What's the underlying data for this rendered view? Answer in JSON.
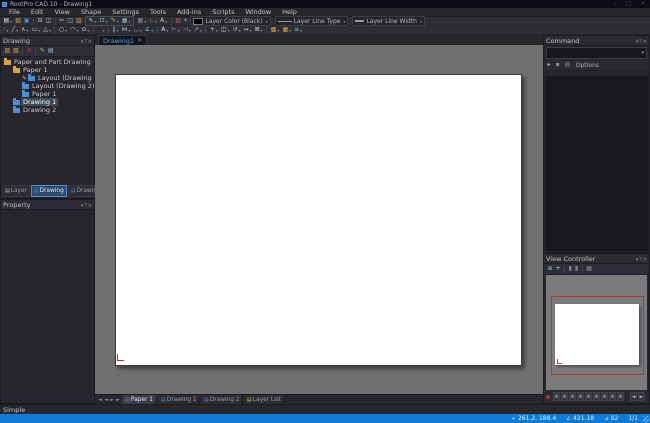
{
  "window": {
    "title": "RootPro CAD 10 - Drawing1",
    "controls": [
      "–",
      "□",
      "×"
    ]
  },
  "menu": [
    "File",
    "Edit",
    "View",
    "Shape",
    "Settings",
    "Tools",
    "Add-ins",
    "Scripts",
    "Window",
    "Help"
  ],
  "glyphs": {
    "caret": "▾",
    "close": "×",
    "panel_buttons": [
      "▾",
      "⊤",
      "×"
    ]
  },
  "toolbar_top": {
    "file_group": [
      {
        "name": "new-file",
        "glyph": "▤",
        "color": "#e4e4ea",
        "dropdown": true
      },
      {
        "name": "open-file",
        "glyph": "▧",
        "color": "#d9a33c"
      },
      {
        "name": "save-file",
        "glyph": "▣",
        "color": "#4d8fd6"
      },
      {
        "sep": true
      },
      {
        "name": "print",
        "glyph": "⊟",
        "color": "#b8b8c0"
      },
      {
        "name": "print-preview",
        "glyph": "◫",
        "color": "#b8b8c0"
      },
      {
        "sep": true
      },
      {
        "name": "cut",
        "glyph": "✂",
        "color": "#c0c0c8"
      },
      {
        "name": "copy",
        "glyph": "◫",
        "color": "#9fb6d4"
      },
      {
        "name": "paste",
        "glyph": "▥",
        "color": "#d9a33c"
      }
    ],
    "select_group": [
      {
        "name": "select-tool",
        "glyph": "↖",
        "color": "#e8e8ee",
        "dropdown": true
      },
      {
        "name": "select-filter",
        "glyph": "⊡",
        "color": "#9fb6d4",
        "dropdown": true
      },
      {
        "name": "snap-tool",
        "glyph": "✎",
        "color": "#d9c23c",
        "dropdown": true
      },
      {
        "name": "snap-color",
        "glyph": "▦",
        "color": "#9fb6d4",
        "dropdown": true
      }
    ],
    "view_group": [
      {
        "name": "grid-toggle",
        "glyph": "▦",
        "color": "#8a8a94",
        "dropdown": true
      },
      {
        "name": "ortho-toggle",
        "glyph": "∟",
        "color": "#8a8a94",
        "dropdown": true
      },
      {
        "name": "annotation",
        "glyph": "A",
        "color": "#c8c8d0",
        "dropdown": true
      },
      {
        "sep": true
      },
      {
        "name": "format-paint",
        "glyph": "▨",
        "color": "#c05050"
      },
      {
        "name": "more-tools",
        "glyph": "▾",
        "color": "#8a8a94"
      }
    ],
    "layer_color": {
      "label": "Layer Color (Black)",
      "swatch": "#000000"
    },
    "layer_line_type": {
      "label": "Layer Line Type"
    },
    "layer_line_width": {
      "label": "Layer Line Width"
    }
  },
  "toolbar_draw": {
    "tools": [
      {
        "name": "point",
        "glyph": "·",
        "color": "#d0d0d8",
        "dropdown": true
      },
      {
        "name": "line",
        "glyph": "╱",
        "color": "#d0d0d8",
        "dropdown": true
      },
      {
        "name": "polyline",
        "glyph": "∧",
        "color": "#d0d0d8",
        "dropdown": true
      },
      {
        "name": "rectangle",
        "glyph": "▭",
        "color": "#d0d0d8",
        "dropdown": true
      },
      {
        "name": "polygon",
        "glyph": "△",
        "color": "#d0d0d8",
        "dropdown": true
      },
      {
        "sep": true
      },
      {
        "name": "circle",
        "glyph": "○",
        "color": "#d0d0d8",
        "dropdown": true
      },
      {
        "name": "arc",
        "glyph": "◠",
        "color": "#d0d0d8",
        "dropdown": true
      },
      {
        "name": "ellipse",
        "glyph": "⊙",
        "color": "#d0d0d8",
        "dropdown": true
      },
      {
        "sep": true
      },
      {
        "name": "hatch",
        "glyph": "▪",
        "color": "#2a2a30",
        "dropdown": true
      },
      {
        "sep": true
      },
      {
        "name": "offset",
        "glyph": "∥",
        "color": "#9fb6d4",
        "dropdown": true
      },
      {
        "name": "mirror",
        "glyph": "⋈",
        "color": "#9fb6d4",
        "dropdown": true
      },
      {
        "name": "fillet",
        "glyph": "◡",
        "color": "#9fb6d4",
        "dropdown": true
      },
      {
        "name": "chamfer",
        "glyph": "∠",
        "color": "#9fb6d4",
        "dropdown": true
      },
      {
        "sep": true
      },
      {
        "name": "text",
        "glyph": "A",
        "color": "#e0e0e6",
        "dropdown": true
      },
      {
        "name": "dimension-linear",
        "glyph": "⊢",
        "color": "#9fb6d4",
        "dropdown": true
      },
      {
        "name": "dimension-vertical",
        "glyph": "⊣",
        "color": "#9fb6d4",
        "dropdown": true
      },
      {
        "name": "leader",
        "glyph": "↗",
        "color": "#9fb6d4",
        "dropdown": true
      },
      {
        "sep": true
      },
      {
        "name": "move",
        "glyph": "+",
        "color": "#c8c8d0",
        "dropdown": true
      },
      {
        "name": "copy-shape",
        "glyph": "◫",
        "color": "#c8c8d0",
        "dropdown": true
      },
      {
        "name": "rotate",
        "glyph": "↺",
        "color": "#c8c8d0",
        "dropdown": true
      },
      {
        "name": "scale",
        "glyph": "↔",
        "color": "#c8c8d0",
        "dropdown": true
      },
      {
        "name": "erase",
        "glyph": "⊠",
        "color": "#c8c8d0",
        "dropdown": true
      },
      {
        "sep": true
      },
      {
        "name": "group",
        "glyph": "▩",
        "color": "#d9a33c",
        "dropdown": true
      },
      {
        "name": "block",
        "glyph": "▦",
        "color": "#d9a33c",
        "dropdown": true
      },
      {
        "name": "measure",
        "glyph": "≡",
        "color": "#9fb6d4",
        "dropdown": true
      }
    ]
  },
  "drawing_panel": {
    "title": "Drawing",
    "toolbar": [
      {
        "name": "add-paper",
        "glyph": "▧",
        "color": "#d9a33c"
      },
      {
        "name": "add-drawing",
        "glyph": "▧",
        "color": "#d9a33c"
      },
      {
        "sep": true
      },
      {
        "name": "delete-drawing",
        "glyph": "✕",
        "color": "#d04040"
      },
      {
        "sep": true
      },
      {
        "name": "edit-drawing",
        "glyph": "✎",
        "color": "#d9c23c"
      },
      {
        "name": "drawing-properties",
        "glyph": "▤",
        "color": "#9fb6d4"
      }
    ],
    "tree": [
      {
        "label": "Paper and Part Drawing",
        "level": 0,
        "icon_color": "#d9a33c"
      },
      {
        "label": "Paper 1",
        "level": 1,
        "icon_color": "#d9a33c"
      },
      {
        "label": "Layout (Drawing 1)",
        "level": 2,
        "icon_color": "#4d8fd6",
        "pencil": true
      },
      {
        "label": "Layout (Drawing 2)",
        "level": 2,
        "icon_color": "#4d8fd6"
      },
      {
        "label": "Paper 1",
        "level": 2,
        "icon_color": "#4d8fd6"
      },
      {
        "label": "Drawing 1",
        "level": 1,
        "icon_color": "#4d8fd6",
        "selected": true
      },
      {
        "label": "Drawing 2",
        "level": 1,
        "icon_color": "#4d8fd6"
      }
    ],
    "tabs": [
      {
        "label": "Layer",
        "icon_color": "#c0c0c8"
      },
      {
        "label": "Drawing",
        "icon_color": "#4d8fd6",
        "active": true
      },
      {
        "label": "Drawing Component",
        "icon_color": "#4d8fd6"
      }
    ]
  },
  "property_panel": {
    "title": "Property"
  },
  "command_panel": {
    "title": "Command",
    "options_label": "Options",
    "toolbar": [
      {
        "name": "command-repeat",
        "glyph": "▸",
        "color": "#9fb6d4"
      },
      {
        "name": "command-back",
        "glyph": "▪",
        "color": "#8a8a94"
      },
      {
        "name": "command-list",
        "glyph": "▤",
        "color": "#8a8a94"
      }
    ]
  },
  "view_controller": {
    "title": "View Controller",
    "toolbar": [
      {
        "name": "zoom-extents",
        "glyph": "⊕",
        "color": "#9fb6d4"
      },
      {
        "name": "pan",
        "glyph": "+",
        "color": "#c8c8d0"
      },
      {
        "sep": true
      },
      {
        "name": "zoom-window",
        "glyph": "▮",
        "color": "#8a8a94"
      },
      {
        "name": "zoom-page",
        "glyph": "▮",
        "color": "#8a8a94"
      },
      {
        "sep": true
      },
      {
        "name": "grid-view",
        "glyph": "▦",
        "color": "#8a8a94"
      }
    ],
    "zoom_buttons": [
      {
        "name": "zoom-preset-1",
        "glyph": "⊕"
      },
      {
        "name": "zoom-preset-2",
        "glyph": "⊕"
      },
      {
        "name": "zoom-preset-3",
        "glyph": "⊕"
      },
      {
        "name": "zoom-preset-4",
        "glyph": "⊕"
      },
      {
        "name": "zoom-preset-5",
        "glyph": "⊕"
      },
      {
        "name": "zoom-preset-6",
        "glyph": "⊕"
      },
      {
        "name": "zoom-preset-7",
        "glyph": "⊕"
      },
      {
        "name": "zoom-preset-8",
        "glyph": "⊕"
      },
      {
        "name": "zoom-preset-9",
        "glyph": "⊕"
      },
      {
        "gap": true
      },
      {
        "name": "prev-view",
        "glyph": "◄"
      },
      {
        "name": "next-view",
        "glyph": "►"
      }
    ]
  },
  "document": {
    "tab_label": "Drawing1",
    "nav_arrows": [
      "◄",
      "◄",
      "►",
      "►"
    ],
    "sheet_tabs": [
      {
        "label": "Paper 1",
        "active": true,
        "icon_color": "#4d8fd6"
      },
      {
        "label": "Drawing 1",
        "icon_color": "#4d8fd6"
      },
      {
        "label": "Drawing 2",
        "icon_color": "#4d8fd6"
      },
      {
        "label": "Layer List",
        "icon_color": "#d9c23c"
      }
    ]
  },
  "status": {
    "message": "Simple",
    "items": [
      {
        "name": "coordinates",
        "icon": "+",
        "text": "261.2, 188.4"
      },
      {
        "name": "zoom-ratio",
        "icon": "∠",
        "text": "421.18"
      },
      {
        "name": "snap-indicator",
        "icon": "⊿",
        "text": "S2"
      },
      {
        "name": "sheet-page",
        "icon": "",
        "text": "1/1"
      }
    ]
  },
  "colors": {
    "accent_blue": "#0f7bd7",
    "selection": "#3e4a5a",
    "canvas_gray": "#707070",
    "page_white": "#ffffff",
    "viewport_outline": "#c03030",
    "folder_yellow": "#d9a33c",
    "folder_blue": "#4d8fd6"
  }
}
